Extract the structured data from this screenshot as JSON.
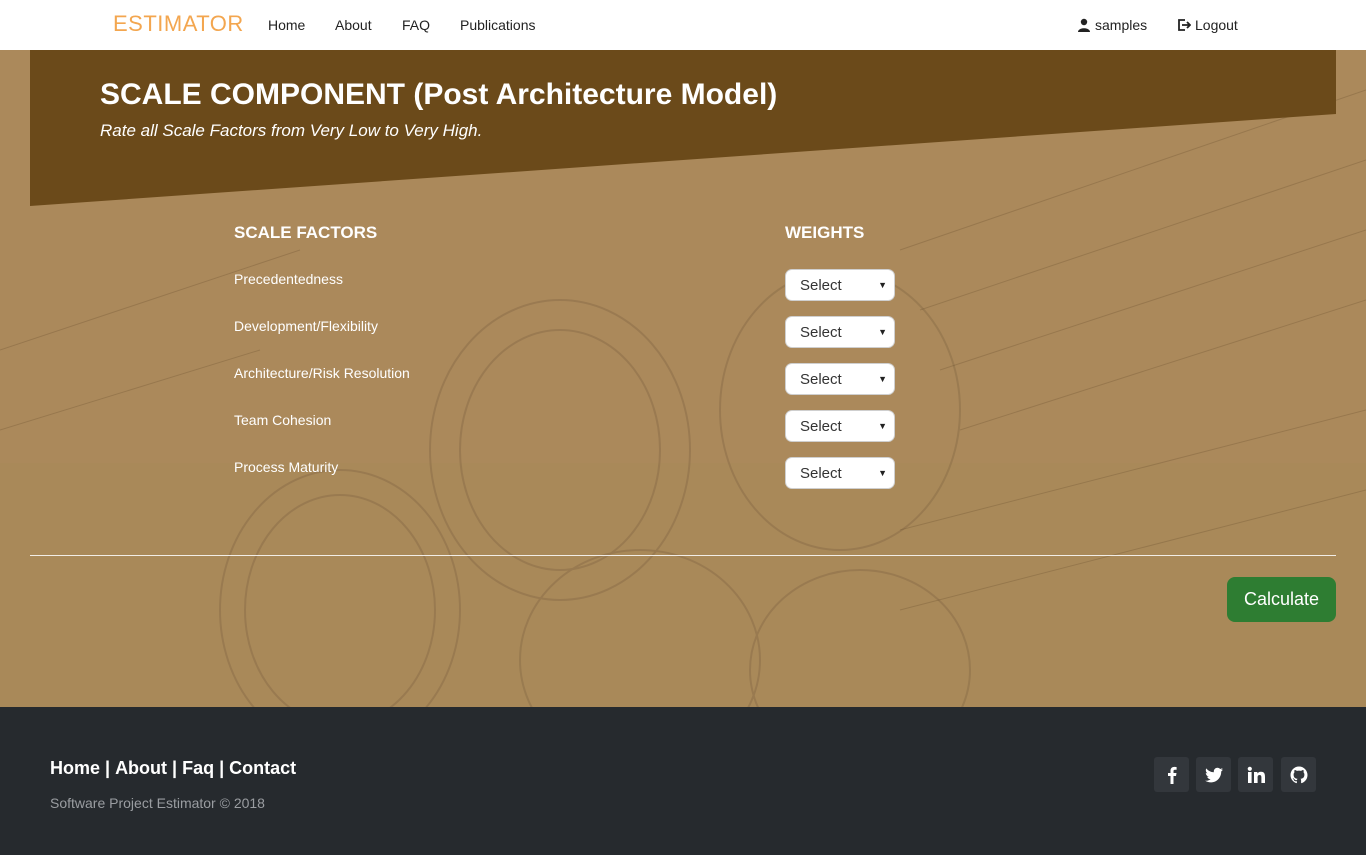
{
  "nav": {
    "brand": "ESTIMATOR",
    "links": [
      "Home",
      "About",
      "FAQ",
      "Publications"
    ],
    "user": "samples",
    "logout": "Logout"
  },
  "banner": {
    "title": "SCALE COMPONENT (Post Architecture Model)",
    "subtitle": "Rate all Scale Factors from Very Low to Very High."
  },
  "table": {
    "col_factors": "SCALE FACTORS",
    "col_weights": "WEIGHTS",
    "factors": [
      "Precedentedness",
      "Development/Flexibility",
      "Architecture/Risk Resolution",
      "Team Cohesion",
      "Process Maturity"
    ],
    "select_value": "Select"
  },
  "actions": {
    "calculate": "Calculate"
  },
  "footer": {
    "links": [
      "Home",
      "About",
      "Faq",
      "Contact"
    ],
    "separator": "|",
    "copyright": "Software Project Estimator © 2018",
    "social_icons": [
      "facebook-icon",
      "twitter-icon",
      "linkedin-icon",
      "github-icon"
    ]
  },
  "colors": {
    "brand": "#f3a64f",
    "banner": "#6b4a1a",
    "calculate": "#2e7d32",
    "footer": "#262a2e"
  }
}
